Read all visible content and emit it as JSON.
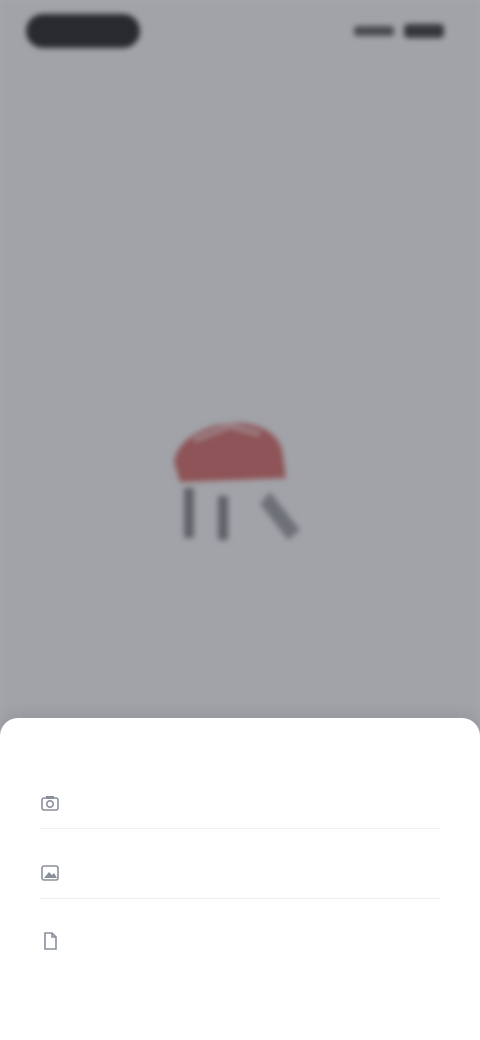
{
  "header": {
    "title": "",
    "subtitle": ""
  },
  "empty_state": {
    "line1": "",
    "line2": "",
    "line3": ""
  },
  "sheet": {
    "title": "",
    "options": [
      {
        "label": "",
        "icon": "camera-icon"
      },
      {
        "label": "",
        "icon": "image-icon"
      },
      {
        "label": "",
        "icon": "file-icon"
      }
    ]
  },
  "colors": {
    "scrim": "#3c3e46",
    "accent": "#3e7cc9",
    "illustration_red": "#c8423f"
  }
}
